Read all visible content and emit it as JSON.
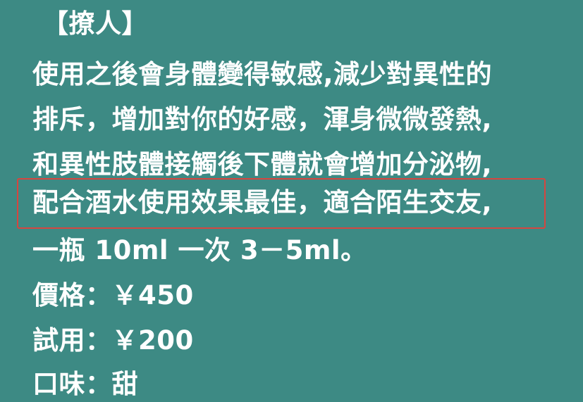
{
  "title": "【撩人】",
  "description_lines": [
    "使用之後會身體變得敏感,減少對異性的",
    "排斥，增加對你的好感，渾身微微發熱,",
    "和異性肢體接觸後下體就會增加分泌物,",
    "配合酒水使用效果最佳，適合陌生交友,",
    "一瓶 10ml 一次 3－5ml。"
  ],
  "price": "價格：￥450",
  "trial": "試用：￥200",
  "flavor": "口味：甜",
  "highlight_color": "#d6453f",
  "background_color": "#3d8a84"
}
